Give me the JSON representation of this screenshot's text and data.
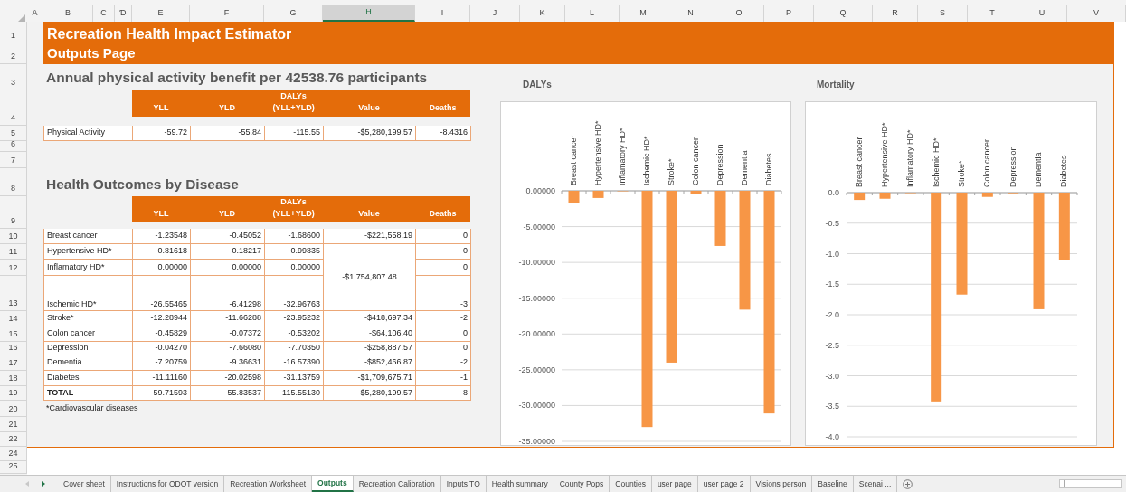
{
  "column_headers": [
    {
      "label": "A",
      "selected": false
    },
    {
      "label": "B",
      "selected": false
    },
    {
      "label": "C",
      "selected": false
    },
    {
      "label": "Ɗ",
      "selected": false
    },
    {
      "label": "E",
      "selected": false
    },
    {
      "label": "F",
      "selected": false
    },
    {
      "label": "G",
      "selected": false
    },
    {
      "label": "H",
      "selected": true
    },
    {
      "label": "I",
      "selected": false
    },
    {
      "label": "J",
      "selected": false
    },
    {
      "label": "K",
      "selected": false
    },
    {
      "label": "L",
      "selected": false
    },
    {
      "label": "M",
      "selected": false
    },
    {
      "label": "N",
      "selected": false
    },
    {
      "label": "O",
      "selected": false
    },
    {
      "label": "P",
      "selected": false
    },
    {
      "label": "Q",
      "selected": false
    },
    {
      "label": "R",
      "selected": false
    },
    {
      "label": "S",
      "selected": false
    },
    {
      "label": "T",
      "selected": false
    },
    {
      "label": "U",
      "selected": false
    },
    {
      "label": "V",
      "selected": false
    }
  ],
  "row_numbers": [
    "1",
    "2",
    "3",
    "4",
    "5",
    "6",
    "7",
    "8",
    "9",
    "10",
    "11",
    "12",
    "13",
    "14",
    "15",
    "16",
    "17",
    "18",
    "19",
    "20",
    "21",
    "22",
    "24",
    "25"
  ],
  "title": "Recreation Health Impact Estimator",
  "subtitle": "Outputs Page",
  "summary": {
    "heading": "Annual physical activity benefit per 42538.76 participants",
    "columns": [
      "YLL",
      "YLD",
      "DALYs\n(YLL+YLD)",
      "Value",
      "Deaths"
    ],
    "row": {
      "label": "Physical Activity",
      "cells": [
        "-59.72",
        "-55.84",
        "-115.55",
        "-$5,280,199.57",
        "-8.4316"
      ]
    }
  },
  "diseases": {
    "heading": "Health Outcomes by Disease",
    "columns": [
      "YLL",
      "YLD",
      "DALYs\n(YLL+YLD)",
      "Value",
      "Deaths"
    ],
    "rows": [
      {
        "label": "Breast cancer",
        "yll": "-1.23548",
        "yld": "-0.45052",
        "dalys": "-1.68600",
        "kind": "single",
        "value": "-$221,558.19",
        "deaths": "0",
        "total": false
      },
      {
        "label": "Hypertensive HD*",
        "yll": "-0.81618",
        "yld": "-0.18217",
        "dalys": "-0.99835",
        "kind": "merge_top",
        "value": "-$1,754,807.48",
        "deaths": "0",
        "total": false
      },
      {
        "label": "Inflamatory HD*",
        "yll": "0.00000",
        "yld": "0.00000",
        "dalys": "0.00000",
        "kind": "merge_in",
        "deaths": "0",
        "total": false
      },
      {
        "label": "Ischemic HD*",
        "yll": "-26.55465",
        "yld": "-6.41298",
        "dalys": "-32.96763",
        "kind": "merge_in",
        "deaths": "-3",
        "total": false
      },
      {
        "label": "Stroke*",
        "yll": "-12.28944",
        "yld": "-11.66288",
        "dalys": "-23.95232",
        "kind": "single",
        "value": "-$418,697.34",
        "deaths": "-2",
        "total": false
      },
      {
        "label": "Colon cancer",
        "yll": "-0.45829",
        "yld": "-0.07372",
        "dalys": "-0.53202",
        "kind": "single",
        "value": "-$64,106.40",
        "deaths": "0",
        "total": false
      },
      {
        "label": "Depression",
        "yll": "-0.04270",
        "yld": "-7.66080",
        "dalys": "-7.70350",
        "kind": "single",
        "value": "-$258,887.57",
        "deaths": "0",
        "total": false
      },
      {
        "label": "Dementia",
        "yll": "-7.20759",
        "yld": "-9.36631",
        "dalys": "-16.57390",
        "kind": "single",
        "value": "-$852,466.87",
        "deaths": "-2",
        "total": false
      },
      {
        "label": "Diabetes",
        "yll": "-11.11160",
        "yld": "-20.02598",
        "dalys": "-31.13759",
        "kind": "single",
        "value": "-$1,709,675.71",
        "deaths": "-1",
        "total": false
      },
      {
        "label": "TOTAL",
        "yll": "-59.71593",
        "yld": "-55.83537",
        "dalys": "-115.55130",
        "kind": "single",
        "value": "-$5,280,199.57",
        "deaths": "-8",
        "total": true
      }
    ],
    "footnote": "*Cardiovascular diseases"
  },
  "charts": [
    {
      "chart_data": {
        "type": "bar",
        "title": "DALYs",
        "categories": [
          "Breast cancer",
          "Hypertensive HD*",
          "Inflamatory HD*",
          "Ischemic HD*",
          "Stroke*",
          "Colon cancer",
          "Depression",
          "Dementia",
          "Diabetes"
        ],
        "series": [
          {
            "color": "#f79646",
            "values": [
              -1.7,
              -1.0,
              0,
              -33.0,
              -24.0,
              -0.5,
              -7.7,
              -16.6,
              -31.1
            ]
          }
        ],
        "ylim": [
          -35,
          0
        ],
        "grid": true,
        "yticks": [
          {
            "value": 0,
            "label": "0.00000"
          },
          {
            "value": -5,
            "label": "-5.00000"
          },
          {
            "value": -10,
            "label": "-10.00000"
          },
          {
            "value": -15,
            "label": "-15.00000"
          },
          {
            "value": -20,
            "label": "-20.00000"
          },
          {
            "value": -25,
            "label": "-25.00000"
          },
          {
            "value": -30,
            "label": "-30.00000"
          },
          {
            "value": -35,
            "label": "-35.00000"
          }
        ]
      }
    },
    {
      "chart_data": {
        "type": "bar",
        "title": "Mortality",
        "categories": [
          "Breast cancer",
          "Hypertensive HD*",
          "Inflamatory HD*",
          "Ischemic HD*",
          "Stroke*",
          "Colon cancer",
          "Depression",
          "Dementia",
          "Diabetes"
        ],
        "series": [
          {
            "color": "#f79646",
            "values": [
              -0.12,
              -0.1,
              0,
              -3.42,
              -1.67,
              -0.07,
              -0.01,
              -1.91,
              -1.1
            ]
          }
        ],
        "ylim": [
          -4,
          0
        ],
        "grid": true,
        "yticks": [
          {
            "value": 0,
            "label": "0.0"
          },
          {
            "value": -0.5,
            "label": "-0.5"
          },
          {
            "value": -1,
            "label": "-1.0"
          },
          {
            "value": -1.5,
            "label": "-1.5"
          },
          {
            "value": -2,
            "label": "-2.0"
          },
          {
            "value": -2.5,
            "label": "-2.5"
          },
          {
            "value": -3,
            "label": "-3.0"
          },
          {
            "value": -3.5,
            "label": "-3.5"
          },
          {
            "value": -4,
            "label": "-4.0"
          }
        ]
      }
    }
  ],
  "sheet_tabs": [
    {
      "label": "Cover sheet",
      "selected": false
    },
    {
      "label": "Instructions for ODOT version",
      "selected": false
    },
    {
      "label": "Recreation Worksheet",
      "selected": false
    },
    {
      "label": "Outputs",
      "selected": true
    },
    {
      "label": "Recreation Calibration",
      "selected": false
    },
    {
      "label": "Inputs TO",
      "selected": false
    },
    {
      "label": "Health summary",
      "selected": false
    },
    {
      "label": "County Pops",
      "selected": false
    },
    {
      "label": "Counties",
      "selected": false
    },
    {
      "label": "user page",
      "selected": false
    },
    {
      "label": "user page 2",
      "selected": false
    },
    {
      "label": "Visions person",
      "selected": false
    },
    {
      "label": "Baseline",
      "selected": false
    },
    {
      "label": "Scenai ...",
      "selected": false
    }
  ]
}
